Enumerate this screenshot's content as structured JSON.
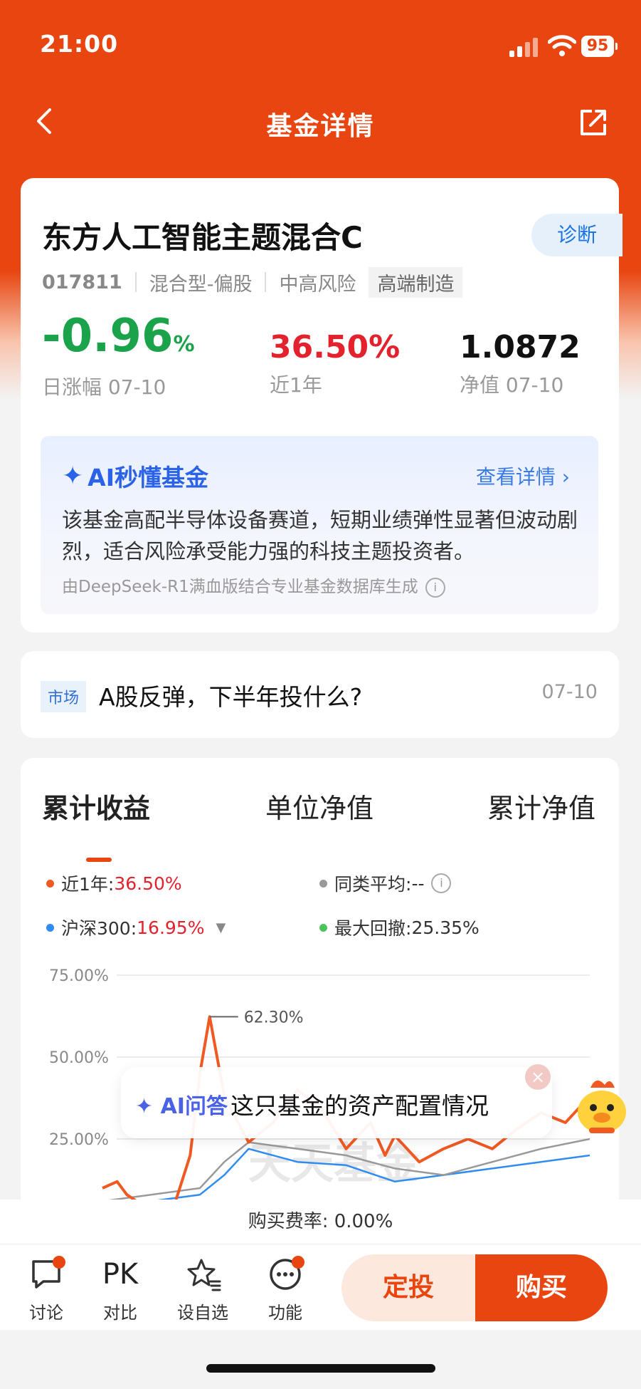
{
  "status": {
    "time": "21:00",
    "battery": "95"
  },
  "nav": {
    "title": "基金详情"
  },
  "fund": {
    "name": "东方人工智能主题混合C",
    "diagnose": "诊断",
    "code": "017811",
    "type": "混合型-偏股",
    "risk": "中高风险",
    "sector_tag": "高端制造",
    "day_change": "-0.96",
    "day_change_unit": "%",
    "day_change_label": "日涨幅 07-10",
    "year_return": "36.50%",
    "year_return_label": "近1年",
    "nav_value": "1.0872",
    "nav_label": "净值 07-10"
  },
  "ai_summary": {
    "title": "AI秒懂基金",
    "detail_link": "查看详情",
    "text": "该基金高配半导体设备赛道，短期业绩弹性显著但波动剧烈，适合风险承受能力强的科技主题投资者。",
    "source": "由DeepSeek-R1满血版结合专业基金数据库生成"
  },
  "news": {
    "tag": "市场",
    "title": "A股反弹，下半年投什么?",
    "date": "07-10"
  },
  "chart_tabs": [
    "累计收益",
    "单位净值",
    "累计净值"
  ],
  "legend": {
    "fund_label": "近1年:",
    "fund_value": "36.50%",
    "peer_label": "同类平均:",
    "peer_value": "--",
    "index_label": "沪深300:",
    "index_value": "16.95%",
    "drawdown_label": "最大回撤:",
    "drawdown_value": "25.35%"
  },
  "colors": {
    "fund": "#f05a22",
    "peer": "#999999",
    "index": "#2f8cf0",
    "drawdown": "#4cc45c"
  },
  "chart_data": {
    "type": "line",
    "y_tick_labels": [
      "75.00%",
      "50.00%",
      "25.00%"
    ],
    "ylim_visible": [
      17,
      75
    ],
    "peak_annotation": "62.30%",
    "watermark": "天天基金",
    "series": [
      {
        "name": "近1年",
        "x": [
          0,
          3,
          5,
          8,
          12,
          15,
          18,
          20,
          22,
          25,
          30,
          35,
          40,
          45,
          50,
          55,
          58,
          60,
          65,
          70,
          75,
          80,
          85,
          90,
          95,
          100
        ],
        "y": [
          10,
          12,
          8,
          5,
          4,
          6,
          20,
          45,
          62.3,
          38,
          24,
          30,
          40,
          34,
          22,
          30,
          20,
          26,
          18,
          22,
          25,
          22,
          28,
          33,
          30,
          38
        ]
      },
      {
        "name": "同类平均",
        "x": [
          0,
          10,
          20,
          25,
          30,
          40,
          50,
          60,
          70,
          80,
          90,
          100
        ],
        "y": [
          6,
          8,
          10,
          18,
          24,
          22,
          20,
          16,
          14,
          18,
          22,
          25
        ]
      },
      {
        "name": "沪深300",
        "x": [
          0,
          10,
          20,
          25,
          30,
          40,
          50,
          60,
          70,
          80,
          90,
          100
        ],
        "y": [
          5,
          6,
          8,
          14,
          22,
          18,
          17,
          12,
          14,
          16,
          18,
          20
        ]
      }
    ]
  },
  "ai_float": {
    "label": "AI问答",
    "question": "这只基金的资产配置情况"
  },
  "fee": {
    "text": "购买费率: 0.00%"
  },
  "bottom_nav": [
    {
      "label": "讨论"
    },
    {
      "label": "对比",
      "glyph": "PK"
    },
    {
      "label": "设自选"
    },
    {
      "label": "功能"
    }
  ],
  "actions": {
    "dingtou": "定投",
    "buy": "购买"
  }
}
